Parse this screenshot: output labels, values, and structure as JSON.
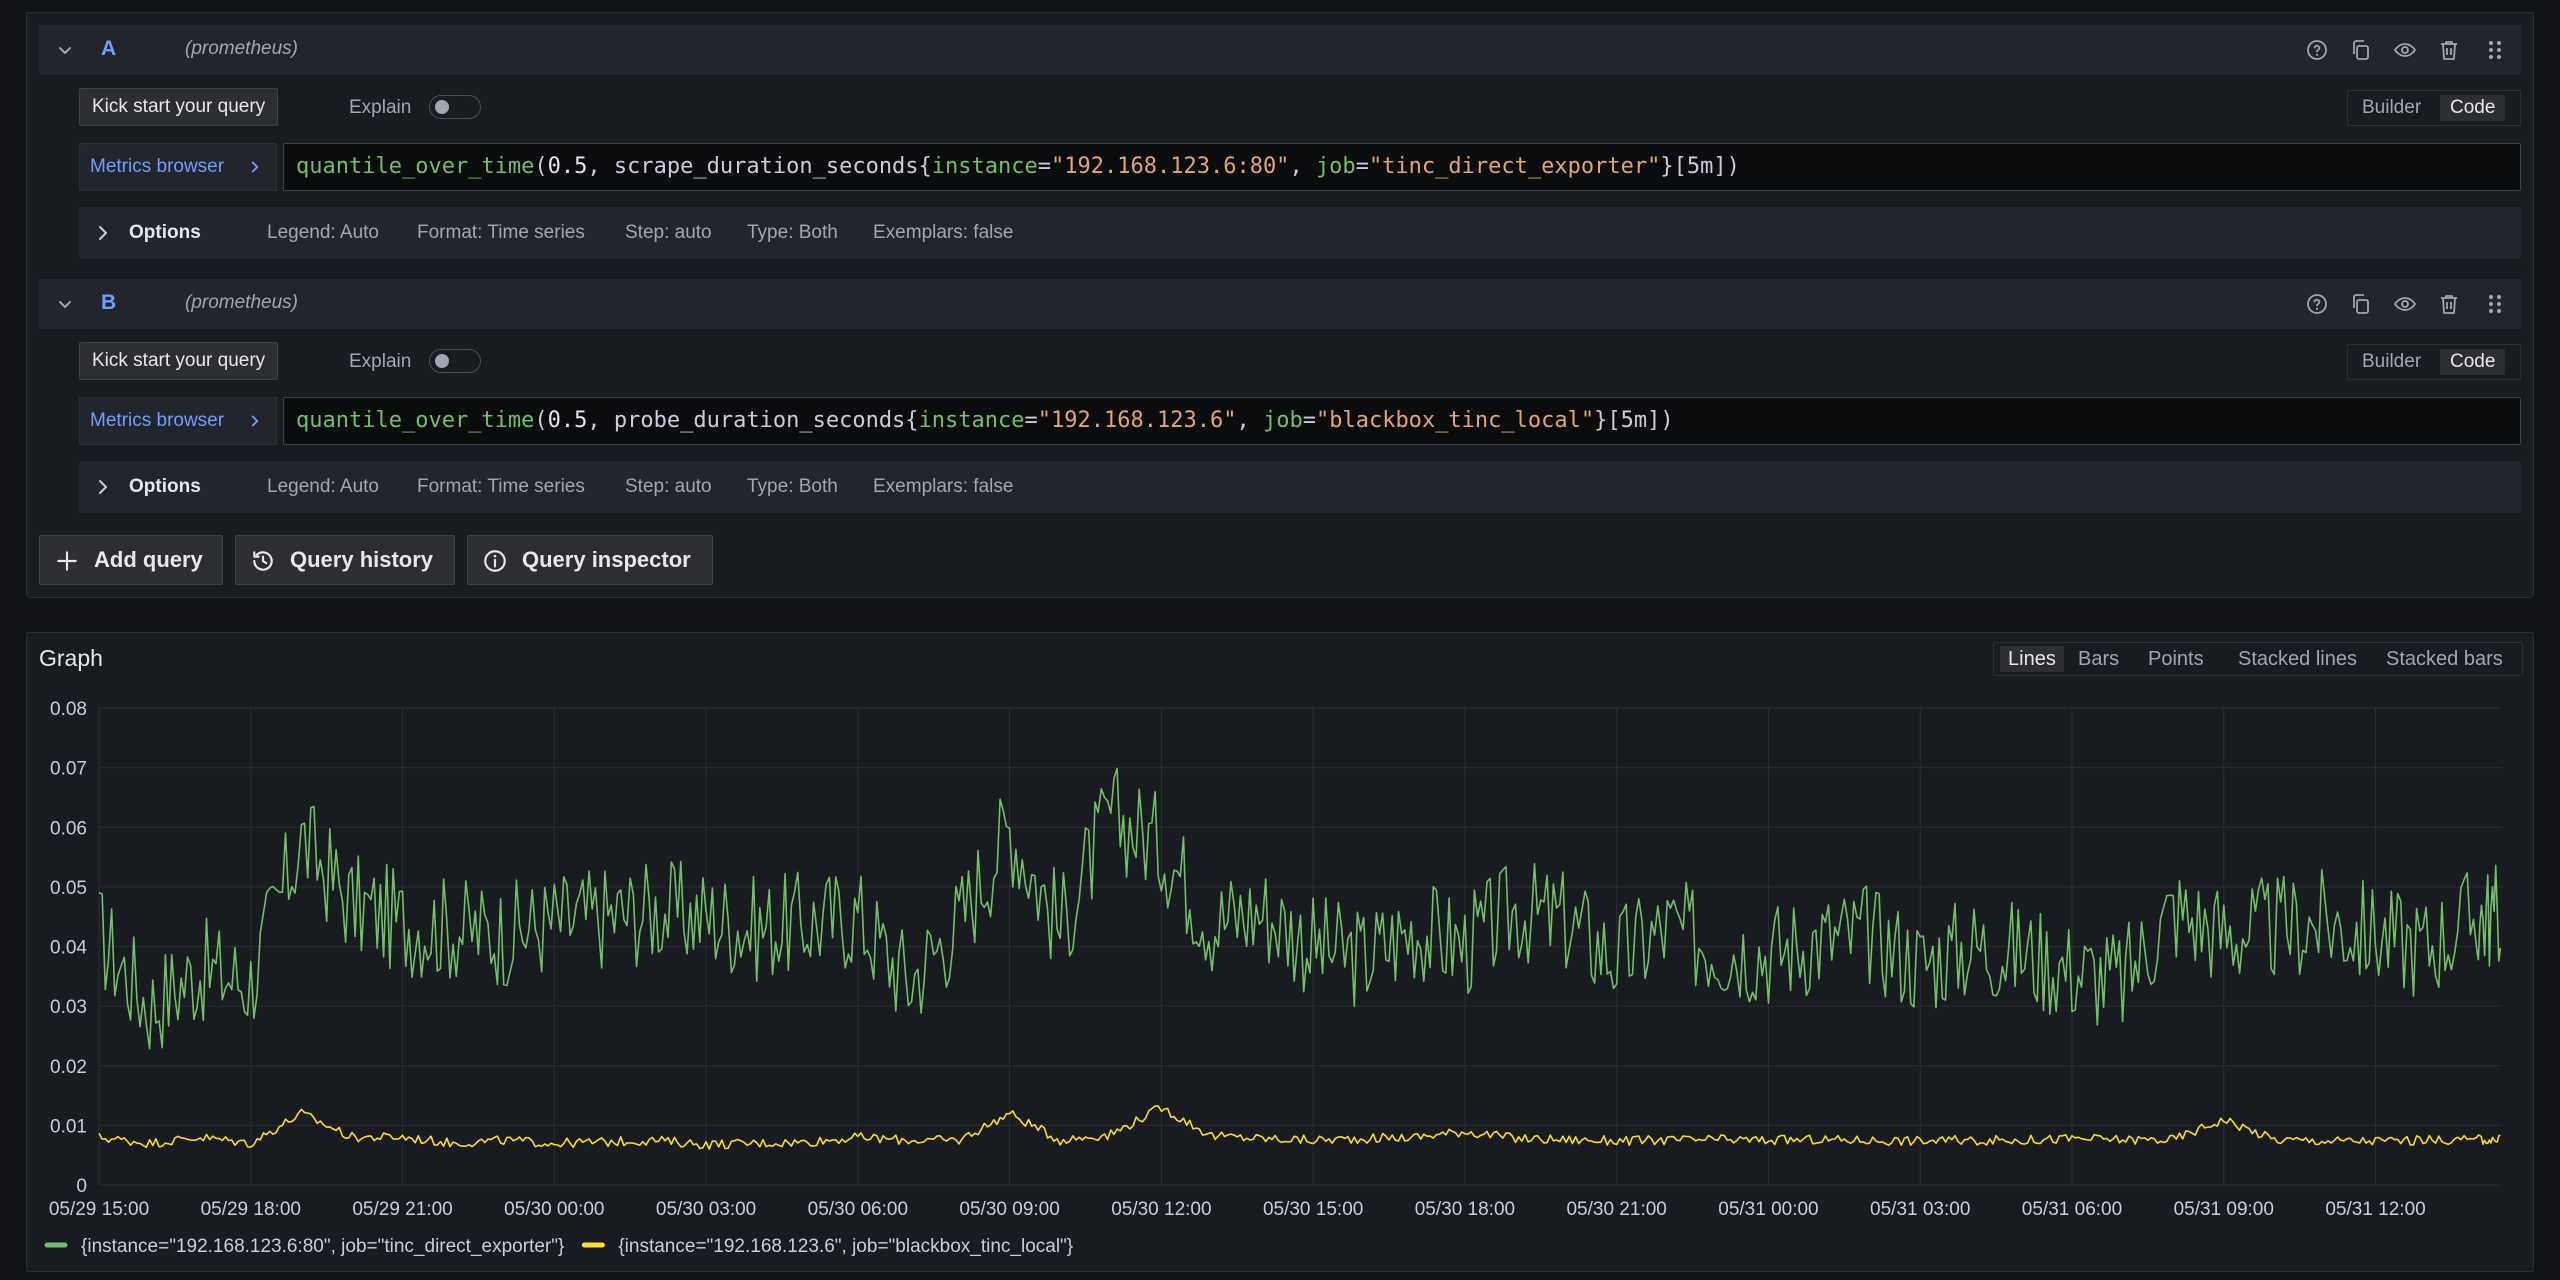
{
  "queries": [
    {
      "ref_id": "A",
      "datasource": "(prometheus)",
      "kick_start_label": "Kick start your query",
      "explain_label": "Explain",
      "explain_on": false,
      "mode_builder": "Builder",
      "mode_code": "Code",
      "metrics_browser_label": "Metrics browser",
      "expr": {
        "fn": "quantile_over_time",
        "p1": "(",
        "num": "0.5",
        "p2": ", scrape_duration_seconds{",
        "l1": "instance",
        "e1": "=",
        "v1": "\"192.168.123.6:80\"",
        "p3": ", ",
        "l2": "job",
        "e2": "=",
        "v2": "\"tinc_direct_exporter\"",
        "p4": "}[5m])"
      },
      "options": {
        "title": "Options",
        "legend": "Legend: Auto",
        "format": "Format: Time series",
        "step": "Step: auto",
        "type": "Type: Both",
        "exemplars": "Exemplars: false"
      }
    },
    {
      "ref_id": "B",
      "datasource": "(prometheus)",
      "kick_start_label": "Kick start your query",
      "explain_label": "Explain",
      "explain_on": false,
      "mode_builder": "Builder",
      "mode_code": "Code",
      "metrics_browser_label": "Metrics browser",
      "expr": {
        "fn": "quantile_over_time",
        "p1": "(",
        "num": "0.5",
        "p2": ", probe_duration_seconds{",
        "l1": "instance",
        "e1": "=",
        "v1": "\"192.168.123.6\"",
        "p3": ", ",
        "l2": "job",
        "e2": "=",
        "v2": "\"blackbox_tinc_local\"",
        "p4": "}[5m])"
      },
      "options": {
        "title": "Options",
        "legend": "Legend: Auto",
        "format": "Format: Time series",
        "step": "Step: auto",
        "type": "Type: Both",
        "exemplars": "Exemplars: false"
      }
    }
  ],
  "header_icons": [
    "help-icon",
    "duplicate-icon",
    "eye-icon",
    "trash-icon",
    "drag-handle-icon"
  ],
  "actions": {
    "add_query": "Add query",
    "query_history": "Query history",
    "query_inspector": "Query inspector"
  },
  "graph": {
    "title": "Graph",
    "modes": [
      "Lines",
      "Bars",
      "Points",
      "Stacked lines",
      "Stacked bars"
    ],
    "active_mode": "Lines"
  },
  "colors": {
    "series_green": "#73bf69",
    "series_yellow": "#fade2a",
    "accent_blue": "#6e9fff"
  },
  "chart_data": {
    "type": "line",
    "title": "Graph",
    "xlabel": "",
    "ylabel": "",
    "ylim": [
      0,
      0.08
    ],
    "yticks": [
      0,
      0.01,
      0.02,
      0.03,
      0.04,
      0.05,
      0.06,
      0.07,
      0.08
    ],
    "ytick_labels": [
      "0",
      "0.01",
      "0.02",
      "0.03",
      "0.04",
      "0.05",
      "0.06",
      "0.07",
      "0.08"
    ],
    "xticks": [
      "05/29 15:00",
      "05/29 18:00",
      "05/29 21:00",
      "05/30 00:00",
      "05/30 03:00",
      "05/30 06:00",
      "05/30 09:00",
      "05/30 12:00",
      "05/30 15:00",
      "05/30 18:00",
      "05/30 21:00",
      "05/31 00:00",
      "05/31 03:00",
      "05/31 06:00",
      "05/31 09:00",
      "05/31 12:00"
    ],
    "x_start": "05/29 15:00",
    "x_end": "05/31 14:30",
    "grid": true,
    "legend_position": "bottom-left",
    "series": [
      {
        "name": "{instance=\"192.168.123.6:80\", job=\"tinc_direct_exporter\"}",
        "color": "#73bf69",
        "x": [
          "05/29 15:00",
          "05/29 16:00",
          "05/29 17:00",
          "05/29 18:00",
          "05/29 19:00",
          "05/29 20:00",
          "05/29 21:00",
          "05/29 22:00",
          "05/29 23:00",
          "05/30 00:00",
          "05/30 01:00",
          "05/30 02:00",
          "05/30 03:00",
          "05/30 04:00",
          "05/30 05:00",
          "05/30 06:00",
          "05/30 07:00",
          "05/30 08:00",
          "05/30 09:00",
          "05/30 10:00",
          "05/30 11:00",
          "05/30 12:00",
          "05/30 13:00",
          "05/30 14:00",
          "05/30 15:00",
          "05/30 16:00",
          "05/30 17:00",
          "05/30 18:00",
          "05/30 19:00",
          "05/30 20:00",
          "05/30 21:00",
          "05/30 22:00",
          "05/30 23:00",
          "05/31 00:00",
          "05/31 01:00",
          "05/31 02:00",
          "05/31 03:00",
          "05/31 04:00",
          "05/31 05:00",
          "05/31 06:00",
          "05/31 07:00",
          "05/31 08:00",
          "05/31 09:00",
          "05/31 10:00",
          "05/31 11:00",
          "05/31 12:00",
          "05/31 13:00",
          "05/31 14:00"
        ],
        "values": [
          0.042,
          0.03,
          0.036,
          0.034,
          0.058,
          0.047,
          0.044,
          0.043,
          0.042,
          0.044,
          0.045,
          0.046,
          0.045,
          0.043,
          0.044,
          0.045,
          0.034,
          0.044,
          0.06,
          0.043,
          0.062,
          0.057,
          0.044,
          0.046,
          0.04,
          0.038,
          0.043,
          0.04,
          0.046,
          0.044,
          0.038,
          0.043,
          0.04,
          0.039,
          0.041,
          0.042,
          0.037,
          0.04,
          0.039,
          0.036,
          0.034,
          0.046,
          0.042,
          0.043,
          0.044,
          0.042,
          0.04,
          0.045
        ]
      },
      {
        "name": "{instance=\"192.168.123.6\", job=\"blackbox_tinc_local\"}",
        "color": "#fade2a",
        "x": [
          "05/29 15:00",
          "05/29 16:00",
          "05/29 17:00",
          "05/29 18:00",
          "05/29 19:00",
          "05/29 20:00",
          "05/29 21:00",
          "05/29 22:00",
          "05/29 23:00",
          "05/30 00:00",
          "05/30 01:00",
          "05/30 02:00",
          "05/30 03:00",
          "05/30 04:00",
          "05/30 05:00",
          "05/30 06:00",
          "05/30 07:00",
          "05/30 08:00",
          "05/30 09:00",
          "05/30 10:00",
          "05/30 11:00",
          "05/30 12:00",
          "05/30 13:00",
          "05/30 14:00",
          "05/30 15:00",
          "05/30 16:00",
          "05/30 17:00",
          "05/30 18:00",
          "05/30 19:00",
          "05/30 20:00",
          "05/30 21:00",
          "05/30 22:00",
          "05/30 23:00",
          "05/31 00:00",
          "05/31 01:00",
          "05/31 02:00",
          "05/31 03:00",
          "05/31 04:00",
          "05/31 05:00",
          "05/31 06:00",
          "05/31 07:00",
          "05/31 08:00",
          "05/31 09:00",
          "05/31 10:00",
          "05/31 11:00",
          "05/31 12:00",
          "05/31 13:00",
          "05/31 14:00"
        ],
        "values": [
          0.008,
          0.007,
          0.008,
          0.007,
          0.012,
          0.008,
          0.008,
          0.007,
          0.0075,
          0.007,
          0.0072,
          0.0075,
          0.0068,
          0.007,
          0.0072,
          0.008,
          0.0075,
          0.0075,
          0.012,
          0.0075,
          0.0085,
          0.013,
          0.0082,
          0.0078,
          0.0075,
          0.0078,
          0.008,
          0.009,
          0.0078,
          0.0076,
          0.0074,
          0.0075,
          0.0076,
          0.0075,
          0.0076,
          0.0075,
          0.0074,
          0.0075,
          0.0075,
          0.0078,
          0.0076,
          0.0076,
          0.011,
          0.0076,
          0.0074,
          0.0074,
          0.0075,
          0.0076
        ]
      }
    ]
  }
}
